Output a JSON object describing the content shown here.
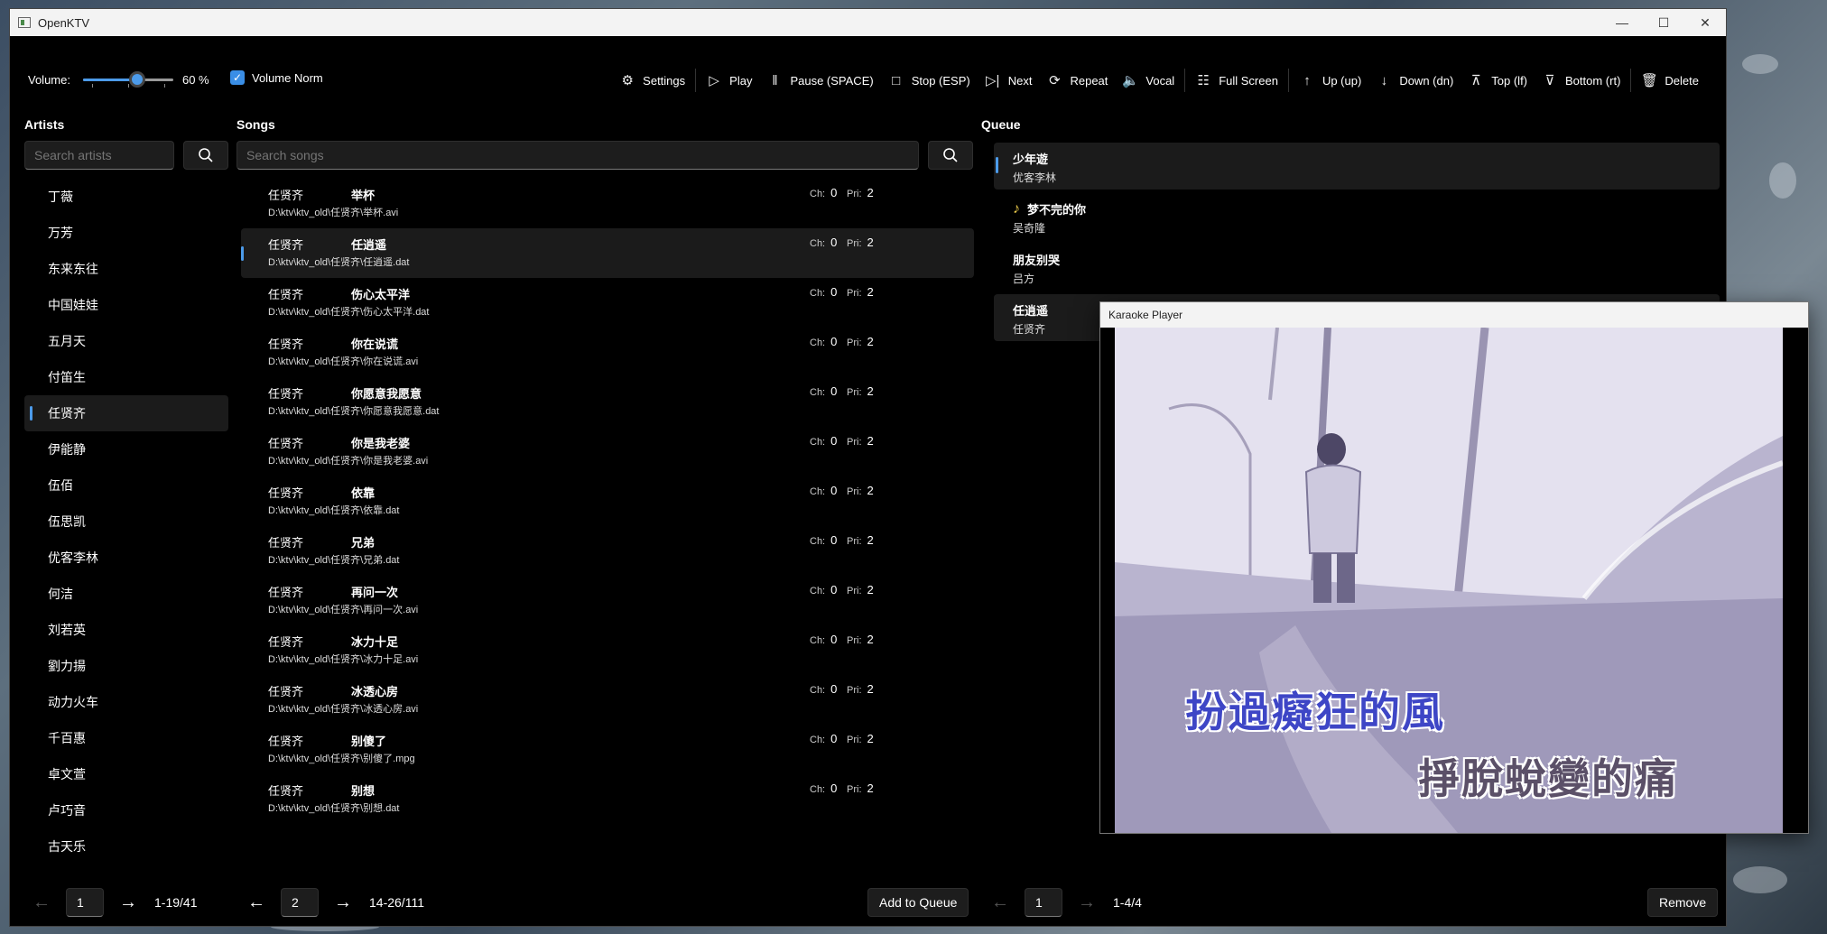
{
  "window": {
    "title": "OpenKTV"
  },
  "toolbar": {
    "volume_label": "Volume:",
    "volume_percent": 60,
    "volume_text": "60 %",
    "volume_norm_label": "Volume Norm",
    "volume_norm_checked": true,
    "buttons": [
      {
        "label": "Settings",
        "icon": "gear-icon"
      },
      {
        "label": "Play",
        "icon": "play-icon"
      },
      {
        "label": "Pause (SPACE)",
        "icon": "pause-icon"
      },
      {
        "label": "Stop (ESP)",
        "icon": "stop-icon"
      },
      {
        "label": "Next",
        "icon": "next-icon"
      },
      {
        "label": "Repeat",
        "icon": "repeat-icon"
      },
      {
        "label": "Vocal",
        "icon": "speaker-icon"
      },
      {
        "label": "Full Screen",
        "icon": "fullscreen-icon"
      },
      {
        "label": "Up (up)",
        "icon": "arrow-up-icon"
      },
      {
        "label": "Down (dn)",
        "icon": "arrow-down-icon"
      },
      {
        "label": "Top (lf)",
        "icon": "to-top-icon"
      },
      {
        "label": "Bottom (rt)",
        "icon": "to-bottom-icon"
      },
      {
        "label": "Delete",
        "icon": "trash-icon"
      }
    ]
  },
  "artists": {
    "header": "Artists",
    "search_placeholder": "Search artists",
    "selected_index": 6,
    "items": [
      "丁薇",
      "万芳",
      "东来东往",
      "中国娃娃",
      "五月天",
      "付笛生",
      "任贤齐",
      "伊能静",
      "伍佰",
      "伍思凯",
      "优客李林",
      "何洁",
      "刘若英",
      "劉力揚",
      "动力火车",
      "千百惠",
      "卓文萱",
      "卢巧音",
      "古天乐"
    ],
    "pager": {
      "page": "1",
      "info": "1-19/41"
    }
  },
  "songs": {
    "header": "Songs",
    "search_placeholder": "Search songs",
    "selected_index": 1,
    "ch_label": "Ch:",
    "pri_label": "Pri:",
    "items": [
      {
        "artist": "任贤齐",
        "title": "举杯",
        "path": "D:\\ktv\\ktv_old\\任贤齐\\举杯.avi",
        "ch": "0",
        "pri": "2"
      },
      {
        "artist": "任贤齐",
        "title": "任逍遥",
        "path": "D:\\ktv\\ktv_old\\任贤齐\\任逍遥.dat",
        "ch": "0",
        "pri": "2"
      },
      {
        "artist": "任贤齐",
        "title": "伤心太平洋",
        "path": "D:\\ktv\\ktv_old\\任贤齐\\伤心太平洋.dat",
        "ch": "0",
        "pri": "2"
      },
      {
        "artist": "任贤齐",
        "title": "你在说谎",
        "path": "D:\\ktv\\ktv_old\\任贤齐\\你在说谎.avi",
        "ch": "0",
        "pri": "2"
      },
      {
        "artist": "任贤齐",
        "title": "你愿意我愿意",
        "path": "D:\\ktv\\ktv_old\\任贤齐\\你愿意我愿意.dat",
        "ch": "0",
        "pri": "2"
      },
      {
        "artist": "任贤齐",
        "title": "你是我老婆",
        "path": "D:\\ktv\\ktv_old\\任贤齐\\你是我老婆.avi",
        "ch": "0",
        "pri": "2"
      },
      {
        "artist": "任贤齐",
        "title": "依靠",
        "path": "D:\\ktv\\ktv_old\\任贤齐\\依靠.dat",
        "ch": "0",
        "pri": "2"
      },
      {
        "artist": "任贤齐",
        "title": "兄弟",
        "path": "D:\\ktv\\ktv_old\\任贤齐\\兄弟.dat",
        "ch": "0",
        "pri": "2"
      },
      {
        "artist": "任贤齐",
        "title": "再问一次",
        "path": "D:\\ktv\\ktv_old\\任贤齐\\再问一次.avi",
        "ch": "0",
        "pri": "2"
      },
      {
        "artist": "任贤齐",
        "title": "冰力十足",
        "path": "D:\\ktv\\ktv_old\\任贤齐\\冰力十足.avi",
        "ch": "0",
        "pri": "2"
      },
      {
        "artist": "任贤齐",
        "title": "冰透心房",
        "path": "D:\\ktv\\ktv_old\\任贤齐\\冰透心房.avi",
        "ch": "0",
        "pri": "2"
      },
      {
        "artist": "任贤齐",
        "title": "别傻了",
        "path": "D:\\ktv\\ktv_old\\任贤齐\\别傻了.mpg",
        "ch": "0",
        "pri": "2"
      },
      {
        "artist": "任贤齐",
        "title": "别想",
        "path": "D:\\ktv\\ktv_old\\任贤齐\\别想.dat",
        "ch": "0",
        "pri": "2"
      }
    ],
    "pager": {
      "page": "2",
      "info": "14-26/111"
    },
    "add_to_queue_label": "Add to Queue"
  },
  "queue": {
    "header": "Queue",
    "items": [
      {
        "title": "少年遊",
        "artist": "优客李林",
        "selected": true,
        "playing": false
      },
      {
        "title": "梦不完的你",
        "artist": "吴奇隆",
        "selected": false,
        "playing": true
      },
      {
        "title": "朋友别哭",
        "artist": "吕方",
        "selected": false,
        "playing": false
      },
      {
        "title": "任逍遥",
        "artist": "任贤齐",
        "selected": false,
        "playing": false
      }
    ],
    "pager": {
      "page": "1",
      "info": "1-4/4"
    },
    "remove_label": "Remove"
  },
  "player": {
    "title": "Karaoke Player",
    "lyric_line1": "扮過癡狂的風",
    "lyric_line2": "掙脫蛻變的痛"
  },
  "colors": {
    "accent": "#4c9bea",
    "background": "#000000",
    "selected_row": "#1b1b1b"
  }
}
